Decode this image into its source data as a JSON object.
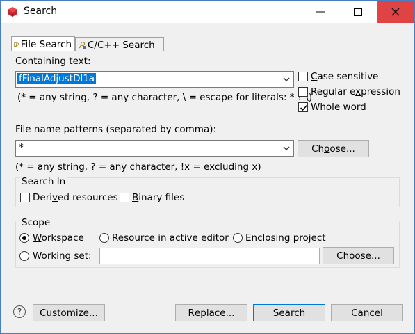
{
  "window": {
    "title": "Search",
    "app_icon": "eclipse-search-icon",
    "minimize_icon": "minimize-icon",
    "maximize_icon": "maximize-icon",
    "close_icon": "close-icon",
    "close_color": "#e04343"
  },
  "tabs": [
    {
      "label": "File Search",
      "active": true,
      "icon": "file-search-icon"
    },
    {
      "label": "C/C++ Search",
      "active": false,
      "icon": "cpp-search-icon"
    }
  ],
  "containing_text": {
    "label_pre": "Containing ",
    "label_u": "t",
    "label_post": "ext:",
    "value": "fFinalAdjustDl1a",
    "hint": "(* = any string, ? = any character, \\ = escape for literals: * ? \\)"
  },
  "options": {
    "case_sensitive": {
      "pre": "",
      "u": "C",
      "post": "ase sensitive",
      "checked": false
    },
    "regular_expression": {
      "pre": "Regular e",
      "u": "x",
      "post": "pression",
      "checked": false
    },
    "whole_word": {
      "pre": "Whole",
      "u": "",
      "post": " word",
      "checked": true,
      "u_mid": "Who",
      "u_char": "l",
      "u_tail": "e word"
    }
  },
  "file_patterns": {
    "label": "File name patterns (separated by comma):",
    "value": "*",
    "choose_pre": "Ch",
    "choose_u": "o",
    "choose_post": "ose...",
    "hint": "(* = any string, ? = any character, !x = excluding x)"
  },
  "search_in": {
    "title": "Search In",
    "derived": {
      "pre": "Deri",
      "u": "v",
      "post": "ed resources",
      "checked": false
    },
    "binary": {
      "pre": "",
      "u": "B",
      "post": "inary files",
      "checked": false
    }
  },
  "scope": {
    "title": "Scope",
    "workspace": {
      "pre": "",
      "u": "W",
      "post": "orkspace",
      "selected": true
    },
    "active_editor": {
      "label": "Resource in active editor",
      "selected": false
    },
    "enclosing_project": {
      "label": "Enclosing project",
      "selected": false
    },
    "working_set": {
      "pre": "Wor",
      "u": "k",
      "post": "ing set:",
      "selected": false,
      "value": ""
    },
    "choose_pre": "C",
    "choose_u": "h",
    "choose_post": "oose..."
  },
  "footer": {
    "help_icon": "help-icon",
    "help_glyph": "?",
    "customize": "Customize...",
    "replace_pre": "",
    "replace_u": "R",
    "replace_post": "eplace...",
    "search": "Search",
    "cancel": "Cancel"
  }
}
